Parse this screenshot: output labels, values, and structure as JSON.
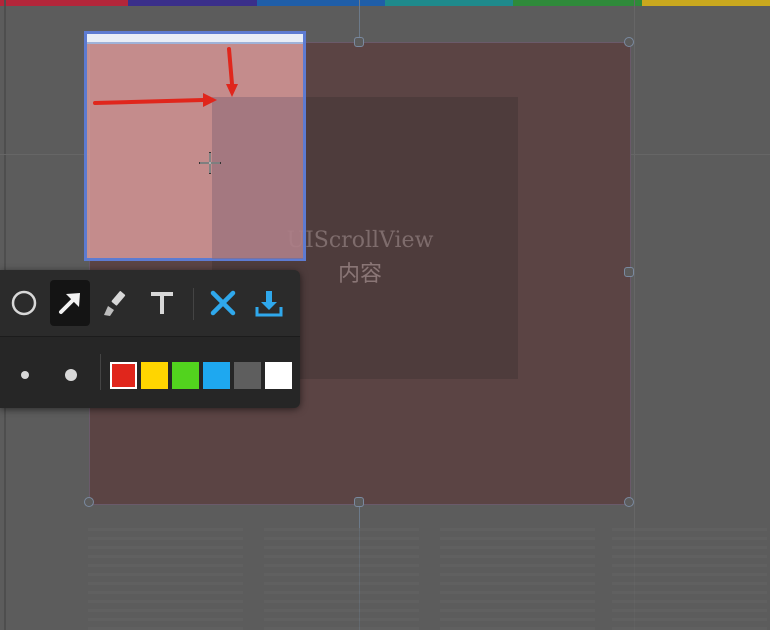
{
  "colors": {
    "accent_selection": "#5d7bd1",
    "arrow_red": "#e0261c",
    "background": "#5c5c5c",
    "top_rainbow": [
      "#b3263a",
      "#3a2f8a",
      "#1f5ea8",
      "#1e8a8c",
      "#2f8a3a",
      "#c9a81e"
    ]
  },
  "canvas": {
    "content_label": "UIScrollView",
    "content_sub": "内容"
  },
  "toolbar": {
    "tools": [
      {
        "name": "ellipse-tool",
        "icon": "circle-outline-icon"
      },
      {
        "name": "arrow-tool",
        "icon": "arrow-up-right-icon",
        "active": true
      },
      {
        "name": "brush-tool",
        "icon": "paintbrush-icon"
      },
      {
        "name": "text-tool",
        "icon": "text-t-icon"
      },
      {
        "name": "cancel-button",
        "icon": "close-x-icon"
      },
      {
        "name": "save-button",
        "icon": "download-icon"
      }
    ],
    "sizes": [
      "small",
      "medium"
    ],
    "palette": [
      "#e0261c",
      "#ffd500",
      "#52d31e",
      "#1ea8f0",
      "#5e5e5e",
      "#ffffff"
    ],
    "selected_color": "#e0261c"
  }
}
